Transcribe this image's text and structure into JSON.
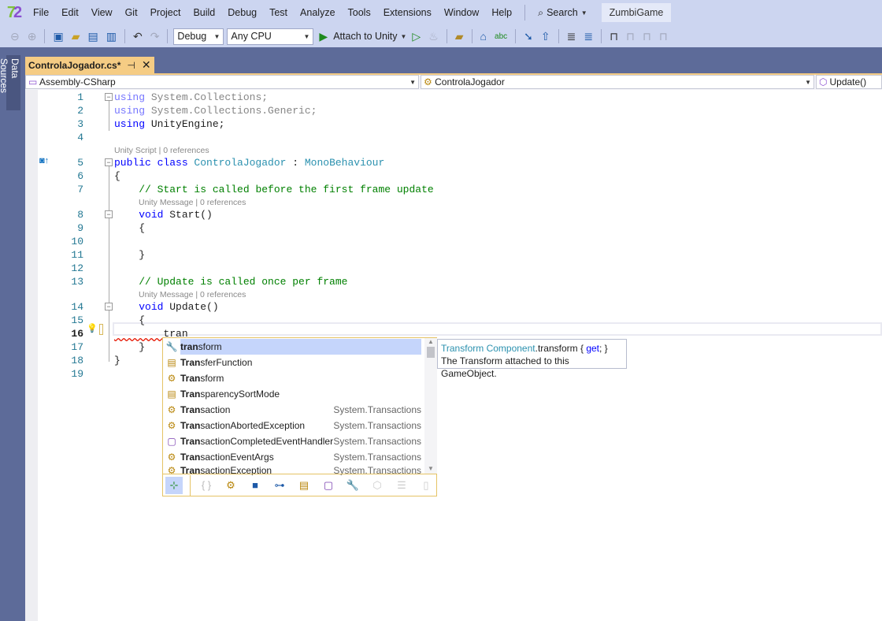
{
  "menubar": {
    "logo": "72",
    "items": [
      "File",
      "Edit",
      "View",
      "Git",
      "Project",
      "Build",
      "Debug",
      "Test",
      "Analyze",
      "Tools",
      "Extensions",
      "Window",
      "Help"
    ],
    "search": "Search",
    "solution": "ZumbiGame"
  },
  "toolbar": {
    "config": "Debug",
    "platform": "Any CPU",
    "attach": "Attach to Unity"
  },
  "sidebar": {
    "data_sources": "Data Sources"
  },
  "tab": {
    "title": "ControlaJogador.cs*",
    "pin": "⊣",
    "close": "✕"
  },
  "navbar": {
    "project": "Assembly-CSharp",
    "class": "ControlaJogador",
    "member": "Update()"
  },
  "editor": {
    "lines": [
      {
        "n": "1",
        "t": [
          [
            "kw dim",
            "using"
          ],
          [
            "dim",
            " System.Collections;"
          ]
        ]
      },
      {
        "n": "2",
        "t": [
          [
            "kw dim",
            "using"
          ],
          [
            "dim",
            " System.Collections.Generic;"
          ]
        ]
      },
      {
        "n": "3",
        "t": [
          [
            "kw",
            "using"
          ],
          [
            "",
            " UnityEngine;"
          ]
        ]
      },
      {
        "n": "4",
        "t": []
      },
      {
        "lens": "Unity Script | 0 references"
      },
      {
        "n": "5",
        "t": [
          [
            "kw",
            "public class "
          ],
          [
            "ty",
            "ControlaJogador"
          ],
          [
            "",
            " : "
          ],
          [
            "ty",
            "MonoBehaviour"
          ]
        ]
      },
      {
        "n": "6",
        "t": [
          [
            "",
            "{"
          ]
        ]
      },
      {
        "n": "7",
        "t": [
          [
            "",
            "    "
          ],
          [
            "cm",
            "// Start is called before the first frame update"
          ]
        ]
      },
      {
        "lens": "Unity Message | 0 references"
      },
      {
        "n": "8",
        "t": [
          [
            "",
            "    "
          ],
          [
            "kw",
            "void"
          ],
          [
            "",
            " Start()"
          ]
        ]
      },
      {
        "n": "9",
        "t": [
          [
            "",
            "    {"
          ]
        ]
      },
      {
        "n": "10",
        "t": []
      },
      {
        "n": "11",
        "t": [
          [
            "",
            "    }"
          ]
        ]
      },
      {
        "n": "12",
        "t": []
      },
      {
        "n": "13",
        "t": [
          [
            "",
            "    "
          ],
          [
            "cm",
            "// Update is called once per frame"
          ]
        ]
      },
      {
        "lens": "Unity Message | 0 references"
      },
      {
        "n": "14",
        "t": [
          [
            "",
            "    "
          ],
          [
            "kw",
            "void"
          ],
          [
            "",
            " Update()"
          ]
        ]
      },
      {
        "n": "15",
        "t": [
          [
            "",
            "    {"
          ]
        ]
      },
      {
        "n": "16",
        "t": [
          [
            "",
            "        tran"
          ]
        ]
      },
      {
        "n": "17",
        "t": [
          [
            "",
            "    }"
          ]
        ]
      },
      {
        "n": "18",
        "t": [
          [
            "",
            "}"
          ]
        ]
      },
      {
        "n": "19",
        "t": []
      }
    ]
  },
  "completion": {
    "typed": "tran",
    "items": [
      {
        "icon": "wrench",
        "bold": "tran",
        "rest": "sform",
        "ns": ""
      },
      {
        "icon": "enum",
        "bold": "Tran",
        "rest": "sferFunction",
        "ns": ""
      },
      {
        "icon": "class",
        "bold": "Tran",
        "rest": "sform",
        "ns": ""
      },
      {
        "icon": "enum",
        "bold": "Tran",
        "rest": "sparencySortMode",
        "ns": ""
      },
      {
        "icon": "class",
        "bold": "Tran",
        "rest": "saction",
        "ns": "System.Transactions"
      },
      {
        "icon": "class",
        "bold": "Tran",
        "rest": "sactionAbortedException",
        "ns": "System.Transactions"
      },
      {
        "icon": "delegate",
        "bold": "Tran",
        "rest": "sactionCompletedEventHandler",
        "ns": "System.Transactions"
      },
      {
        "icon": "class",
        "bold": "Tran",
        "rest": "sactionEventArgs",
        "ns": "System.Transactions"
      },
      {
        "icon": "class",
        "bold": "Tran",
        "rest": "sactionException",
        "ns": "System.Transactions"
      }
    ],
    "filters": [
      "expand",
      "namespace",
      "class",
      "struct",
      "interface",
      "enum",
      "delegate",
      "property",
      "module",
      "snippet",
      "keyword"
    ]
  },
  "tooltip": {
    "type": "Transform",
    "component": "Component",
    "member": ".transform",
    "open": " { ",
    "get": "get",
    "close": "; }",
    "desc": "The Transform attached to this GameObject."
  },
  "colors": {
    "accent": "#f5cc84",
    "selection": "#c5d5fb",
    "keyword": "#0000ff",
    "type": "#2b91af",
    "comment": "#008000"
  }
}
